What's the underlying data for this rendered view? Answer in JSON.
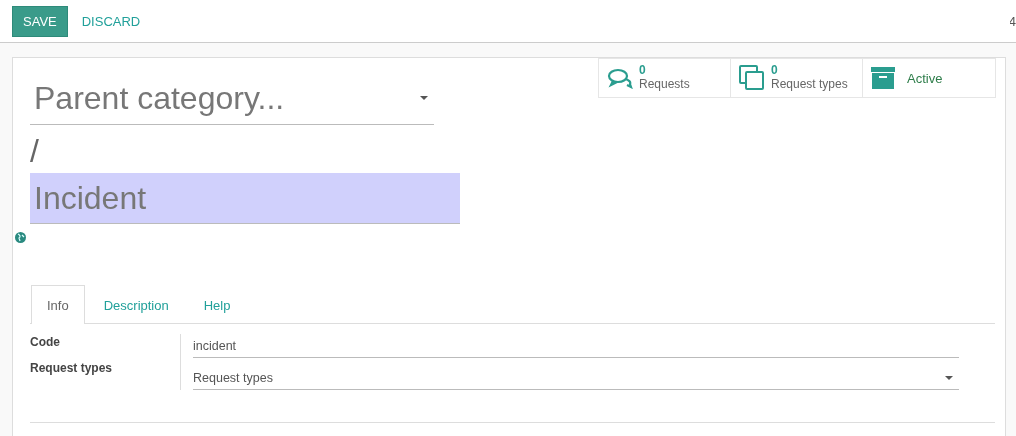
{
  "control_panel": {
    "buttons": [
      {
        "label": "SAVE",
        "kind": "primary"
      },
      {
        "label": "DISCARD",
        "kind": "link"
      }
    ],
    "pager": "4"
  },
  "stat_buttons": [
    {
      "kind": "chat",
      "value": "0",
      "label": "Requests"
    },
    {
      "kind": "copy",
      "value": "0",
      "label": "Request types"
    },
    {
      "kind": "archive",
      "label": "Active"
    }
  ],
  "title": {
    "parent_placeholder": "Parent category...",
    "separator": "/",
    "name": "Incident",
    "name_selected": true
  },
  "tabs": [
    {
      "label": "Info",
      "selected": true
    },
    {
      "label": "Description",
      "selected": false
    },
    {
      "label": "Help",
      "selected": false
    }
  ],
  "fields": [
    {
      "label": "Code",
      "kind": "text",
      "value": "incident"
    },
    {
      "label": "Request types",
      "kind": "select",
      "placeholder": "Request types"
    }
  ]
}
